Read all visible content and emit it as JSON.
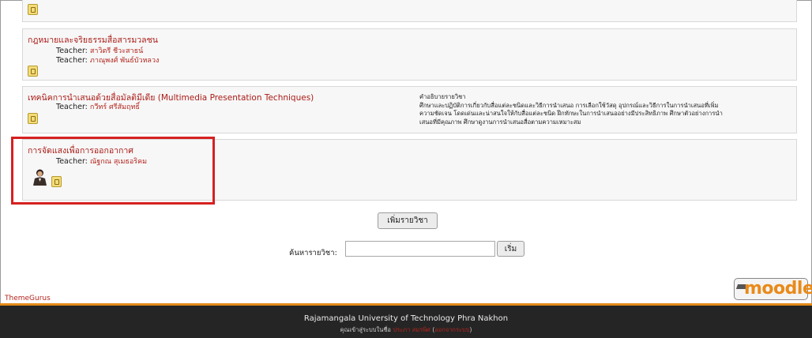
{
  "courses": [
    {
      "title": "กฎหมายและจริยธรรมสื่อสารมวลชน",
      "teachers": [
        {
          "label": "Teacher:",
          "name": "สาวิตรี ชีวะสาธน์"
        },
        {
          "label": "Teacher:",
          "name": "ภาณุพงศ์ พันธ์บัวหลวง"
        }
      ]
    },
    {
      "title": "เทคนิคการนำเสนอด้วยสื่อมัลติมีเดีย (Multimedia Presentation Techniques)",
      "teachers": [
        {
          "label": "Teacher:",
          "name": "กวีทร์ ศรีสัมฤทธิ์"
        }
      ],
      "summary_heading": "คำอธิบายรายวิชา",
      "summary_lines": [
        "ศึกษาและปฏิบัติการเกี่ยวกับสื่อแต่ละชนิดและวิธีการนำเสนอ การเลือกใช้วัสดุ อุปกรณ์และวิธีการในการนำเสนอที่เพิ่ม",
        "ความชัดเจน โดดเด่นและน่าสนใจให้กับสื่อแต่ละชนิด ฝึกทักษะในการนำเสนออย่างมีประสิทธิภาพ ศึกษาตัวอย่างการนำ",
        "เสนอที่มีคุณภาพ ศึกษาดูงานการนำเสนอสื่อตามความเหมาะสม"
      ]
    },
    {
      "title": "การจัดแสงเพื่อการออกอากาศ",
      "teachers": [
        {
          "label": "Teacher:",
          "name": "ณัฐกณ สุเมธอริคม"
        }
      ]
    }
  ],
  "add_course_button": "เพิ่มรายวิชา",
  "search": {
    "label": "ค้นหารายวิชา:",
    "value": "",
    "button": "เริ่ม"
  },
  "theme_credit": "ThemeGurus",
  "footer": {
    "title": "Rajamangala University of Technology Phra Nakhon",
    "login_prefix": "คุณเข้าสู่ระบบในชื่อ",
    "user_name": "ประภา สมรพิศ",
    "logout": "ออกจากระบบ"
  },
  "logo_text": "moodle",
  "colors": {
    "course_link": "#aa1b16",
    "highlight": "#d62020",
    "footer_bg": "#252525",
    "accent": "#e38b19"
  }
}
